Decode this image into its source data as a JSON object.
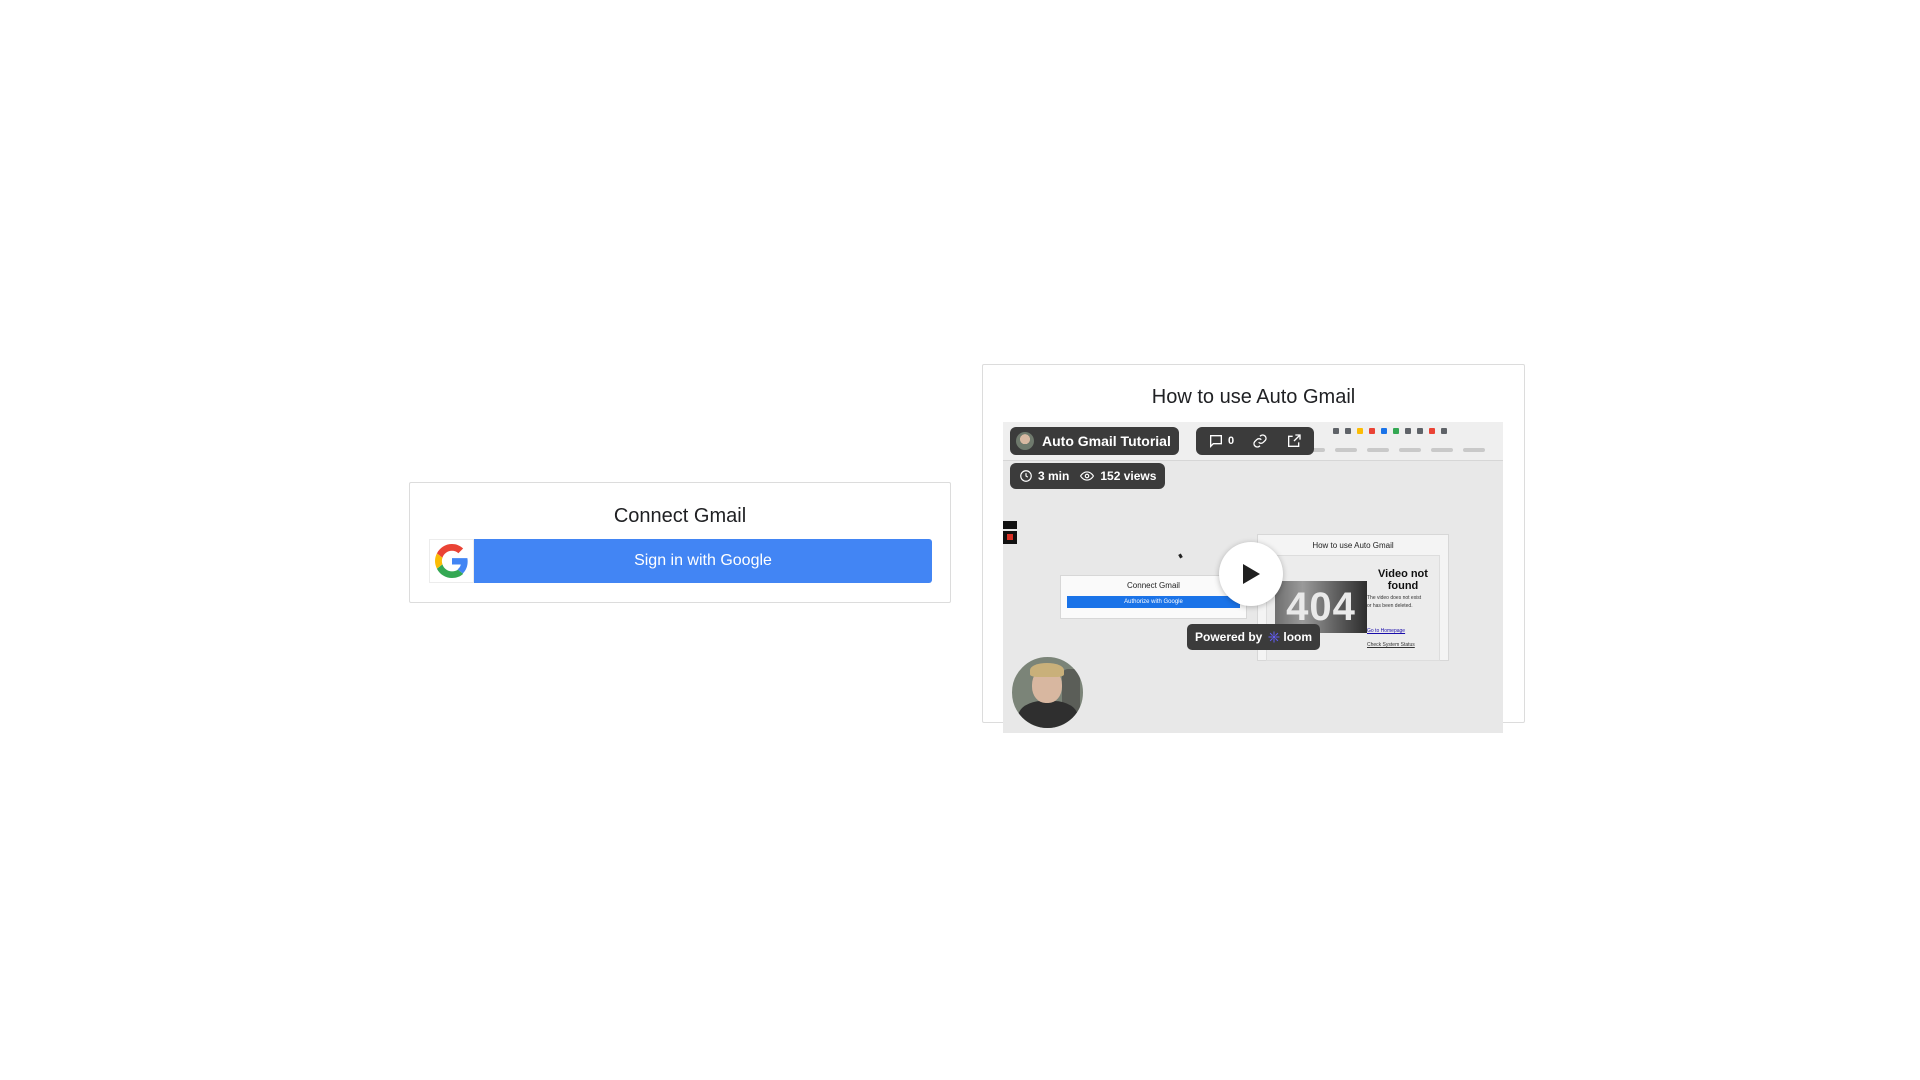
{
  "connect": {
    "title": "Connect Gmail",
    "google_button_label": "Sign in with Google"
  },
  "video_card": {
    "title": "How to use Auto Gmail",
    "video": {
      "title": "Auto Gmail Tutorial",
      "comments_count": "0",
      "duration": "3 min",
      "views": "152 views",
      "powered_by": "Powered by",
      "brand": "loom",
      "preview": {
        "connect_title": "Connect Gmail",
        "connect_button": "Authorize with Google",
        "card_title": "How to use Auto Gmail",
        "not_found_code": "404",
        "not_found_title": "Video not found",
        "not_found_text": "The video does not exist or has been deleted.",
        "link_home": "Go to Homepage",
        "link_status": "Check System Status"
      }
    }
  },
  "colors": {
    "google_blue": "#4285f4",
    "pill_bg": "#3b3b3b",
    "loom_purple": "#625df5"
  },
  "icons": [
    "google-g-icon",
    "comment-icon",
    "link-icon",
    "external-link-icon",
    "clock-icon",
    "eye-icon",
    "play-icon",
    "loom-icon"
  ]
}
